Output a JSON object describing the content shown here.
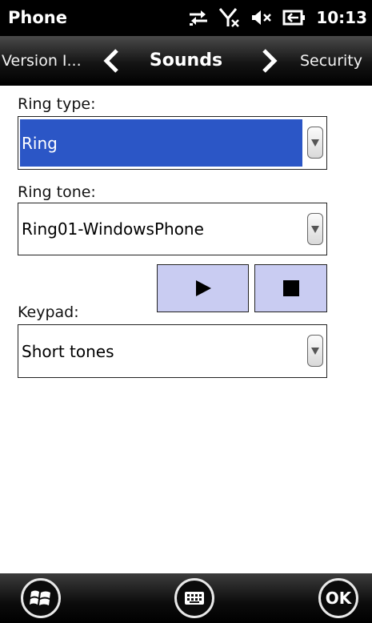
{
  "titlebar": {
    "app_title": "Phone",
    "time": "10:13",
    "icons": [
      "data-transfer-icon",
      "no-signal-icon",
      "speaker-muted-icon",
      "battery-charging-icon"
    ]
  },
  "tabnav": {
    "prev_label": "Version I...",
    "current_label": "Sounds",
    "next_label": "Security"
  },
  "form": {
    "ring_type": {
      "label": "Ring type:",
      "value": "Ring"
    },
    "ring_tone": {
      "label": "Ring tone:",
      "value": "Ring01-WindowsPhone"
    },
    "keypad": {
      "label": "Keypad:",
      "value": "Short tones"
    },
    "playback_icons": [
      "play-icon",
      "stop-icon"
    ]
  },
  "bottombar": {
    "icons": [
      "windows-start-icon",
      "keyboard-icon"
    ],
    "ok_label": "OK"
  },
  "colors": {
    "selection": "#2b56c6",
    "media_button": "#c9ccf2"
  }
}
